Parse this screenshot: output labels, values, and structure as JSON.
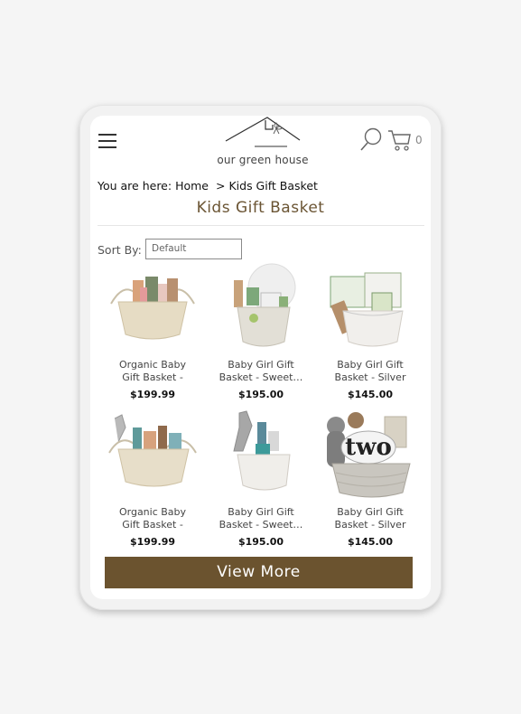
{
  "header": {
    "logo_text": "our green house",
    "cart_count": "0"
  },
  "breadcrumb": {
    "prefix": "You are here:",
    "home": "Home",
    "separator": ">",
    "current": "Kids Gift Basket"
  },
  "page": {
    "title": "Kids Gift Basket"
  },
  "sort": {
    "label": "Sort By:",
    "value": "Default"
  },
  "products": [
    {
      "name": "Organic Baby Gift Basket - Duck…",
      "price": "$199.99"
    },
    {
      "name": "Baby Girl Gift Basket  - Sweet…",
      "price": "$195.00"
    },
    {
      "name": "Baby Girl Gift Basket - Silver",
      "price": "$145.00"
    },
    {
      "name": "Organic Baby Gift Basket - Duck…",
      "price": "$199.99"
    },
    {
      "name": "Baby Girl Gift Basket  - Sweet…",
      "price": "$195.00"
    },
    {
      "name": "Baby Girl Gift Basket - Silver",
      "price": "$145.00"
    }
  ],
  "basket_art": {
    "text": "two"
  },
  "view_more": {
    "label": "View More"
  },
  "colors": {
    "brand_brown": "#6b532f",
    "title_brown": "#6b5534"
  }
}
